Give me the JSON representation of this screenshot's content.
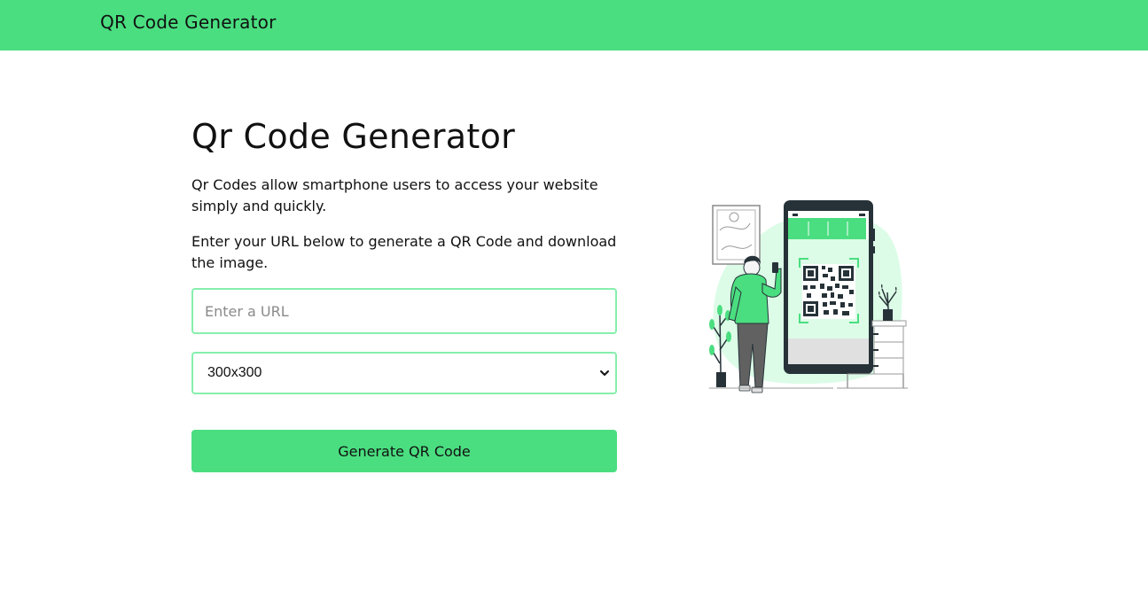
{
  "header": {
    "brand": "QR Code Generator"
  },
  "main": {
    "title": "Qr Code Generator",
    "paragraph1": "Qr Codes allow smartphone users to access your website simply and quickly.",
    "paragraph2": "Enter your URL below to generate a QR Code and download the image.",
    "url_input": {
      "placeholder": "Enter a URL",
      "value": ""
    },
    "size_select": {
      "selected": "300x300",
      "icon": "chevron-down-icon"
    },
    "generate_button": "Generate QR Code"
  },
  "illustration": {
    "icon": "person-scanning-qr-illustration"
  },
  "colors": {
    "accent": "#4ade80",
    "input_border": "#86efac",
    "light_green": "#dcfce7",
    "text": "#111111",
    "dark": "#263238"
  }
}
